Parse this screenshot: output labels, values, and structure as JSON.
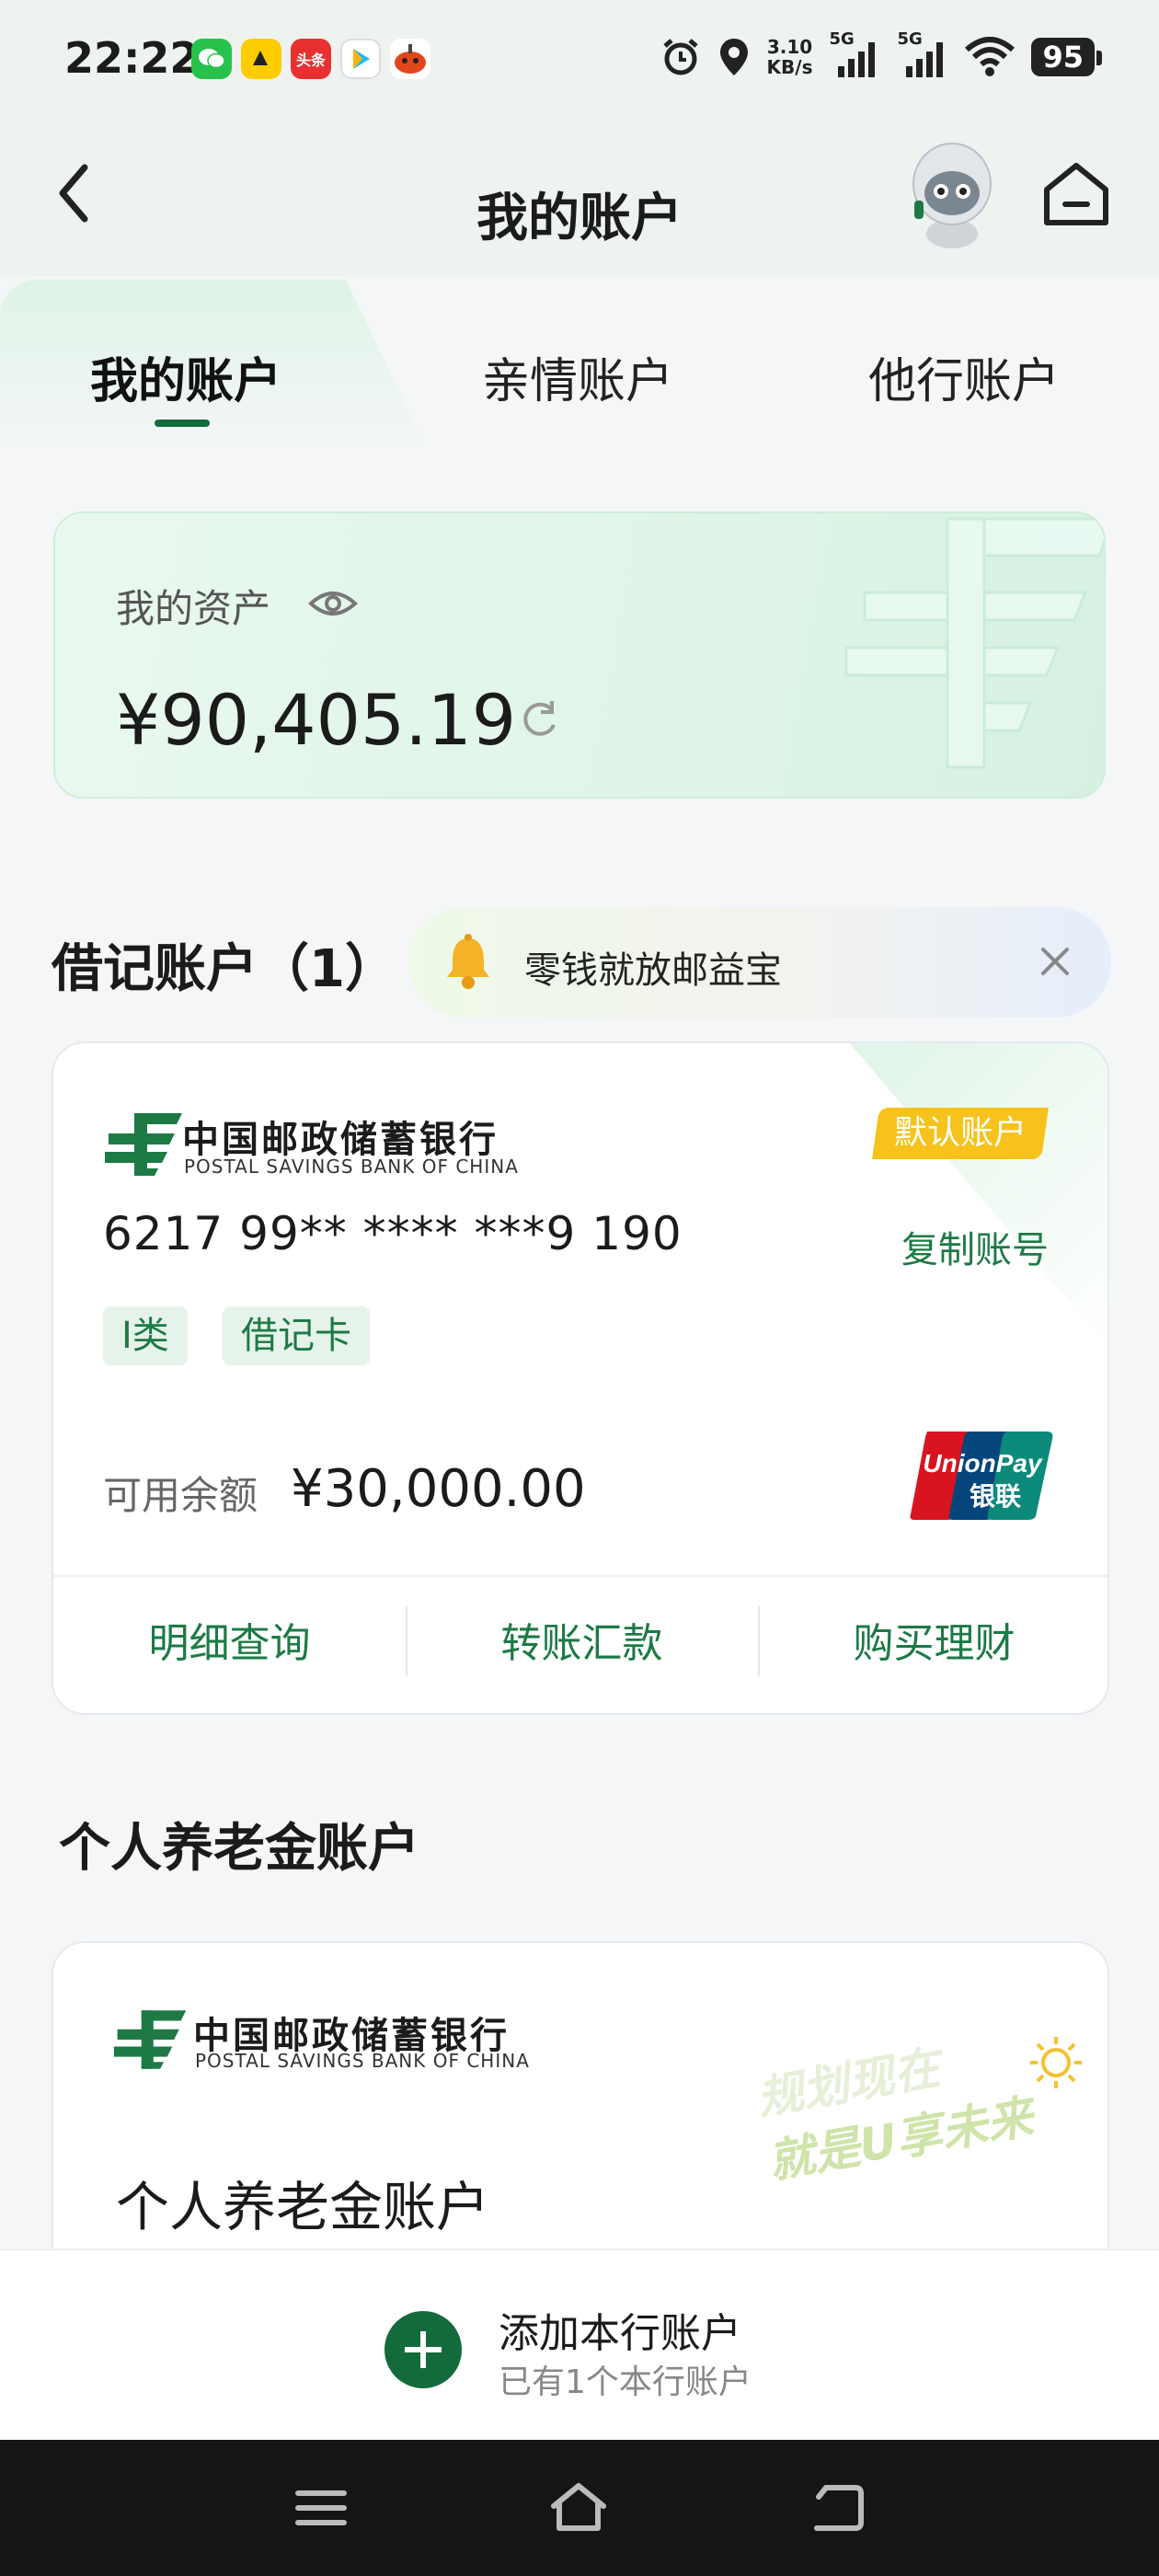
{
  "status_bar": {
    "time": "22:22",
    "speed_value": "3.10",
    "speed_unit": "KB/s",
    "signal_1": "5G",
    "signal_2": "5G",
    "battery": "95",
    "app_icons": [
      "wechat-icon",
      "meituan-icon",
      "toutiao-icon",
      "tencent-video-icon",
      "game-icon"
    ],
    "app_icon_1_text": "头条"
  },
  "header": {
    "title": "我的账户"
  },
  "tabs": [
    {
      "label": "我的账户",
      "active": true
    },
    {
      "label": "亲情账户",
      "active": false
    },
    {
      "label": "他行账户",
      "active": false
    }
  ],
  "assets": {
    "label": "我的资产",
    "value": "¥90,405.19"
  },
  "debit": {
    "title": "借记账户（1）",
    "promo_text": "零钱就放邮益宝",
    "card": {
      "bank_cn": "中国邮政储蓄银行",
      "bank_en": "POSTAL SAVINGS BANK OF CHINA",
      "default_badge": "默认账户",
      "card_number": "6217 99** **** ***9 190",
      "copy_label": "复制账号",
      "tags": [
        "Ⅰ类",
        "借记卡"
      ],
      "balance_label": "可用余额",
      "balance_value": "¥30,000.00",
      "unionpay_en": "UnionPay",
      "unionpay_cn": "银联",
      "actions": [
        "明细查询",
        "转账汇款",
        "购买理财"
      ]
    }
  },
  "pension": {
    "title": "个人养老金账户",
    "card": {
      "bank_cn": "中国邮政储蓄银行",
      "bank_en": "POSTAL SAVINGS BANK OF CHINA",
      "slogan_line1": "规划现在",
      "slogan_line2": "就是U享未来",
      "name": "个人养老金账户"
    }
  },
  "add_bar": {
    "label": "添加本行账户",
    "sub": "已有1个本行账户"
  },
  "colors": {
    "brand_green": "#136b3c",
    "link_green": "#1d7a45",
    "badge_yellow": "#f6c21b"
  }
}
